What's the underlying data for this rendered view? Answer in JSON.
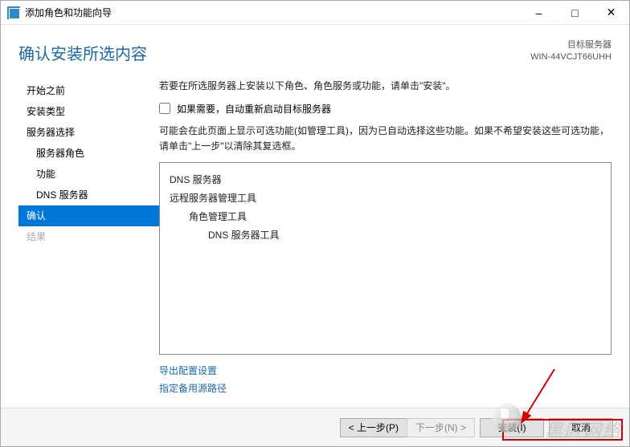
{
  "window": {
    "title": "添加角色和功能向导"
  },
  "header": {
    "page_title": "确认安装所选内容",
    "target_label": "目标服务器",
    "target_name": "WIN-44VCJT66UHH"
  },
  "sidebar": {
    "items": [
      {
        "label": "开始之前",
        "selected": false,
        "disabled": false
      },
      {
        "label": "安装类型",
        "selected": false,
        "disabled": false
      },
      {
        "label": "服务器选择",
        "selected": false,
        "disabled": false
      },
      {
        "label": "服务器角色",
        "selected": false,
        "disabled": false,
        "indent": true
      },
      {
        "label": "功能",
        "selected": false,
        "disabled": false,
        "indent": true
      },
      {
        "label": "DNS 服务器",
        "selected": false,
        "disabled": false,
        "indent": true
      },
      {
        "label": "确认",
        "selected": true,
        "disabled": false
      },
      {
        "label": "结果",
        "selected": false,
        "disabled": true
      }
    ]
  },
  "main": {
    "intro": "若要在所选服务器上安装以下角色、角色服务或功能，请单击\"安装\"。",
    "checkbox_label": "如果需要，自动重新启动目标服务器",
    "checkbox_checked": false,
    "note": "可能会在此页面上显示可选功能(如管理工具)，因为已自动选择这些功能。如果不希望安装这些可选功能，请单击\"上一步\"以清除其复选框。",
    "selection_tree": [
      {
        "level": 1,
        "label": "DNS 服务器"
      },
      {
        "level": 1,
        "label": "远程服务器管理工具"
      },
      {
        "level": 2,
        "label": "角色管理工具"
      },
      {
        "level": 3,
        "label": "DNS 服务器工具"
      }
    ],
    "links": {
      "export": "导出配置设置",
      "alt_source": "指定备用源路径"
    }
  },
  "footer": {
    "previous": "< 上一步(P)",
    "next": "下一步(N) >",
    "install": "安装(I)",
    "cancel": "取消"
  },
  "watermark": "黑区网络"
}
